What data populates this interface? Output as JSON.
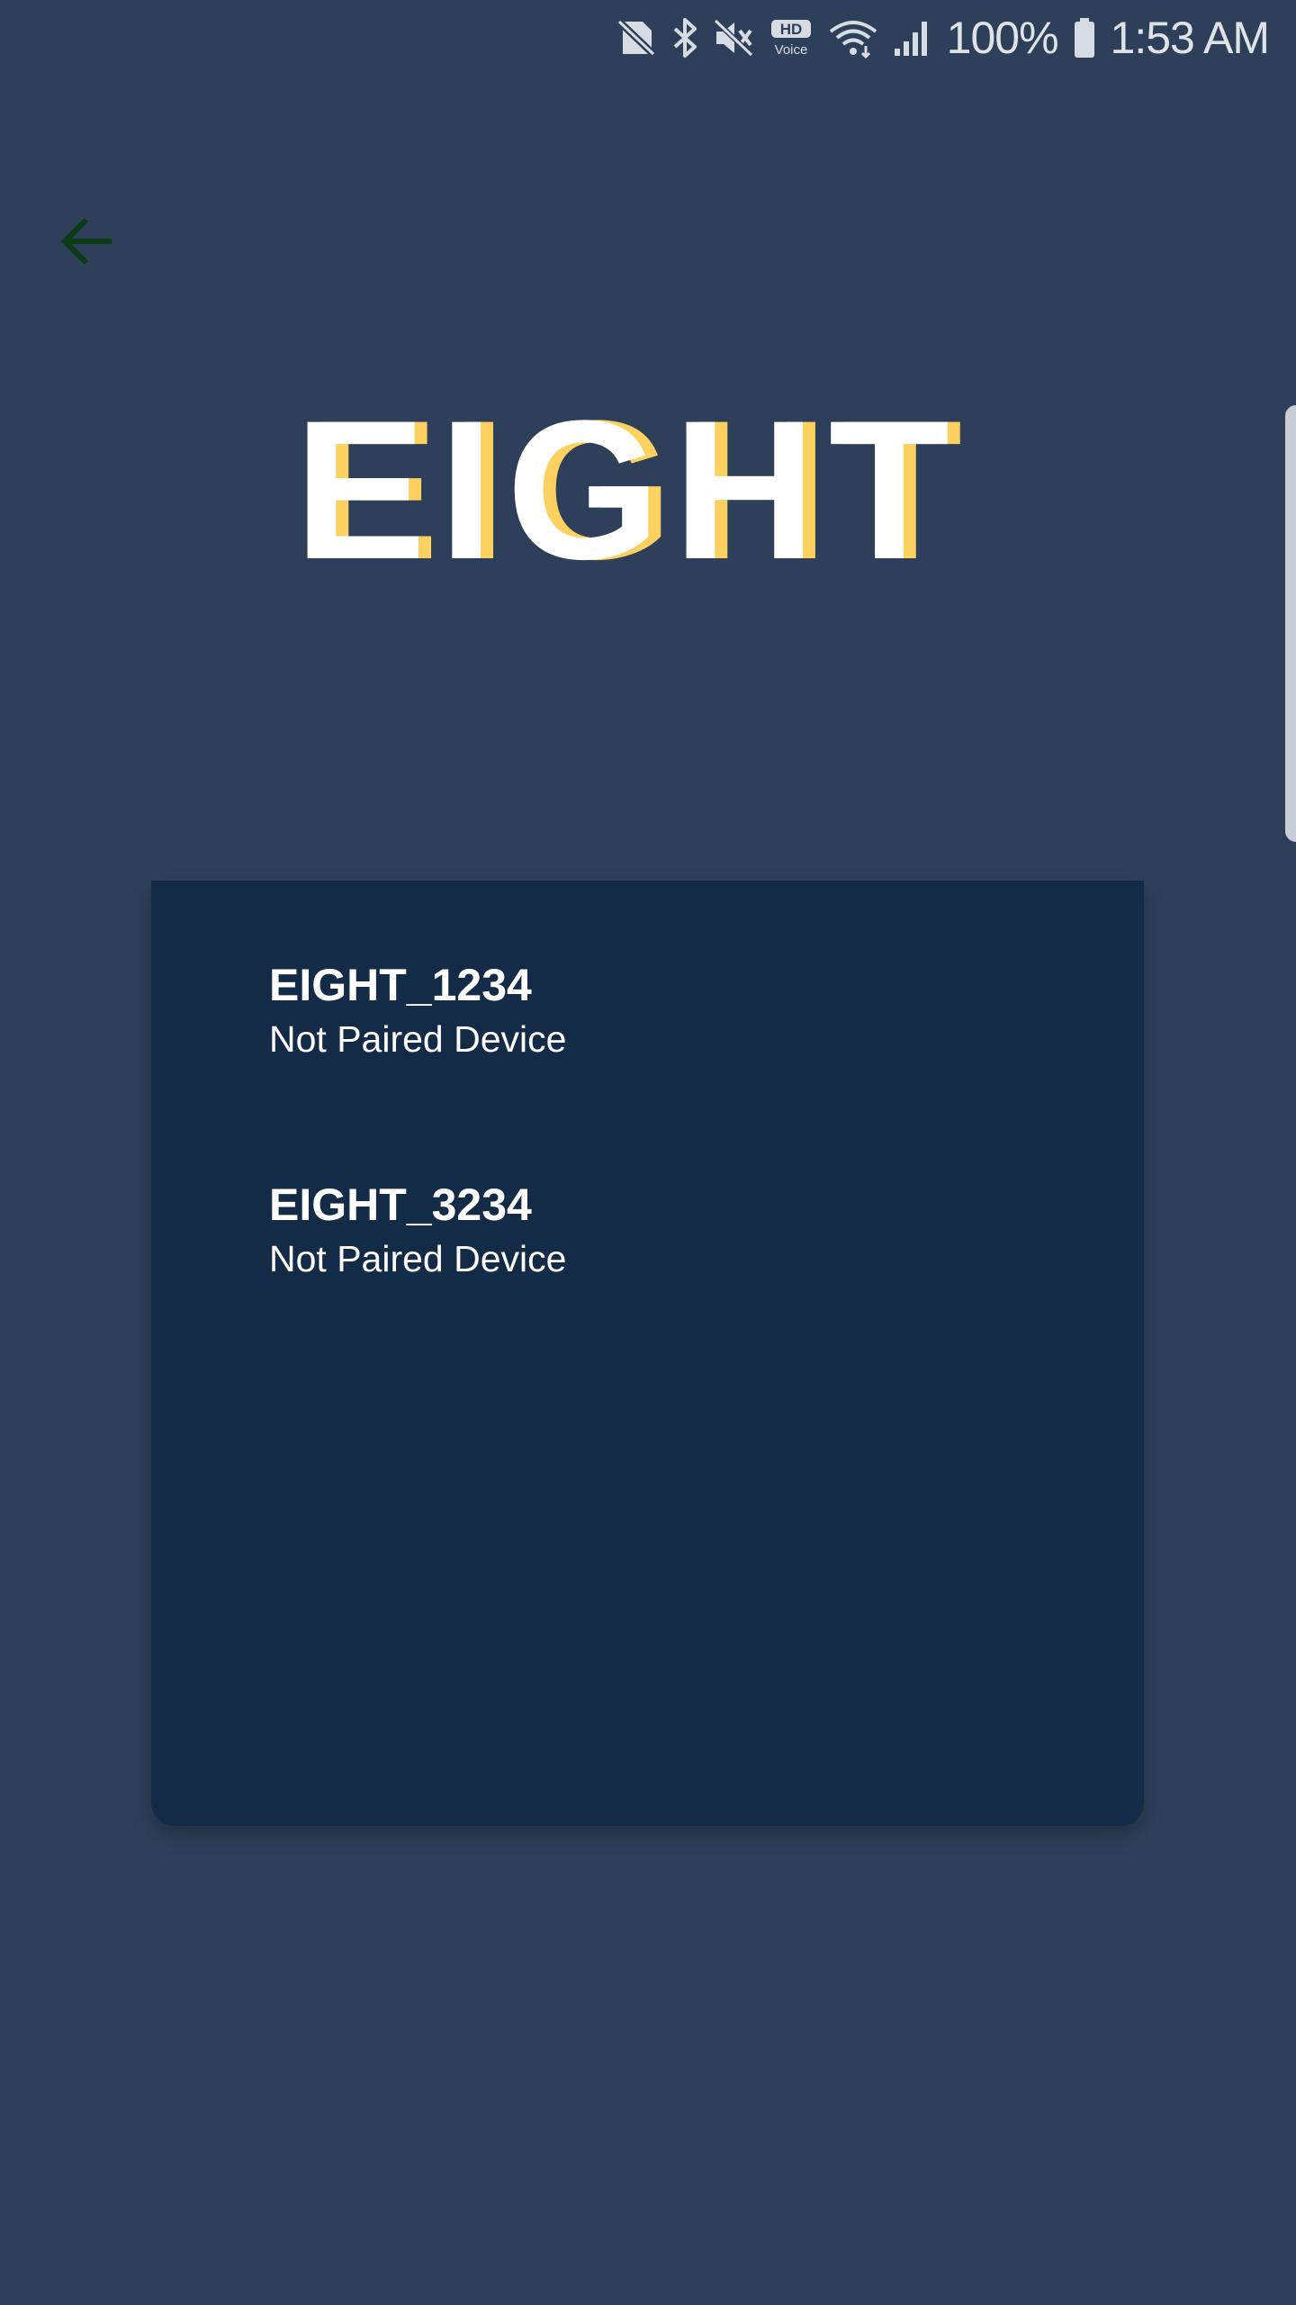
{
  "status_bar": {
    "battery_percent": "100%",
    "time": "1:53 AM",
    "hd_voice_top": "HD",
    "hd_voice_bottom": "Voice",
    "icons": [
      "no-sim-icon",
      "bluetooth-icon",
      "mute-icon",
      "hd-voice-icon",
      "wifi-icon",
      "signal-icon",
      "battery-icon"
    ]
  },
  "header": {
    "back_icon": "arrow-left-icon",
    "back_color": "#0d3b13"
  },
  "logo": {
    "text": "EIGHT",
    "color": "#ffffff",
    "accent_color": "#fdd160"
  },
  "device_list": {
    "background": "#142b47",
    "items": [
      {
        "name": "EIGHT_1234",
        "status": "Not Paired Device"
      },
      {
        "name": "EIGHT_3234",
        "status": "Not Paired Device"
      }
    ]
  }
}
